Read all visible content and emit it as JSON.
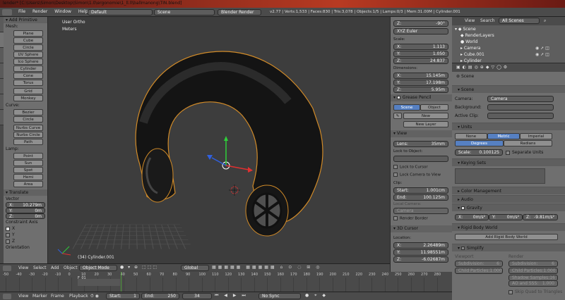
{
  "window": {
    "title": "lender* [C:\\Users\\Simon\\Desktop\\Simon\\1.0\\ergonomie\\1_ll.ll\\ballmanong\\TIN.blend]"
  },
  "topbar": {
    "menus": [
      "File",
      "Render",
      "Window",
      "Help"
    ],
    "layout": "Default",
    "scene": "Scene",
    "engine": "Blender Render",
    "stats": "v2.77 | Verts:1,533 | Faces:830 | Tris:3,078 | Objects:1/5 | Lamps:0/3 | Mem:31.00M | Cylinder.001"
  },
  "toolshelf": {
    "tabs": [
      "Tools",
      "Create",
      "Relations",
      "Animation",
      "Physics",
      "Grease Pencil",
      "Bl Printing"
    ],
    "header": "Add Primitive",
    "mesh_label": "Mesh:",
    "mesh": [
      "Plane",
      "Cube",
      "Circle",
      "UV Sphere",
      "Ico Sphere",
      "Cylinder",
      "Cone",
      "Torus",
      "Grid",
      "Monkey"
    ],
    "curve_label": "Curve:",
    "curve": [
      "Bezier",
      "Circle",
      "Nurbs Curve",
      "Nurbs Circle",
      "Path"
    ],
    "lamp_label": "Lamp:",
    "lamp": [
      "Point",
      "Sun",
      "Spot",
      "Hemi",
      "Area"
    ],
    "op_header": "Translate",
    "vector_label": "Vector",
    "vector": [
      {
        "k": "X:",
        "v": "10.279m"
      },
      {
        "k": "Y:",
        "v": "0m"
      },
      {
        "k": "Z:",
        "v": "0m"
      }
    ],
    "constraint_label": "Constraint Axis",
    "axes": [
      "X",
      "Y",
      "Z"
    ],
    "orientation": "Orientation"
  },
  "viewport": {
    "view_name": "User Ortho",
    "units": "Meters",
    "object_label": "(34) Cylinder.001"
  },
  "npanel": {
    "rot_z": "-90°",
    "rot_mode": "XYZ Euler",
    "scale_label": "Scale:",
    "scale": [
      {
        "k": "X:",
        "v": "1.113"
      },
      {
        "k": "Y:",
        "v": "1.050"
      },
      {
        "k": "Z:",
        "v": "24.837"
      }
    ],
    "dim_label": "Dimensions:",
    "dim": [
      {
        "k": "X:",
        "v": "15.145m"
      },
      {
        "k": "Y:",
        "v": "17.198m"
      },
      {
        "k": "Z:",
        "v": "5.95m"
      }
    ],
    "gp_header": "Grease Pencil",
    "gp_scene": "Scene",
    "gp_object": "Object",
    "gp_new": "New",
    "gp_newlayer": "New Layer",
    "view_header": "View",
    "lens": "Lens:",
    "lens_val": "35mm",
    "lock_obj": "Lock to Object:",
    "lock_cursor": "Lock to Cursor",
    "lock_camera": "Lock Camera to View",
    "clip": "Clip:",
    "clip_start": "Start:",
    "clip_start_val": "1.001cm",
    "clip_end": "End:",
    "clip_end_val": "100.125m",
    "local_camera": "Local Camera:",
    "camera": "Camera",
    "render_border": "Render Border",
    "cursor_header": "3D Cursor",
    "location": "Location:",
    "loc": [
      {
        "k": "X:",
        "v": "2.26489m"
      },
      {
        "k": "Y:",
        "v": "11.98551m"
      },
      {
        "k": "Z:",
        "v": "-6.02687m"
      }
    ]
  },
  "outliner": {
    "menus": [
      "View",
      "Search"
    ],
    "filter": "All Scenes",
    "items": [
      "Scene",
      "RenderLayers",
      "World",
      "Camera",
      "Cube.001",
      "Cylinder"
    ]
  },
  "props": {
    "breadcrumb": "Scene",
    "scene_header": "Scene",
    "camera_label": "Camera:",
    "camera_val": "Camera",
    "bg_label": "Background:",
    "clip_label": "Active Clip:",
    "units_header": "Units",
    "unit_systems": [
      "None",
      "Metric",
      "Imperial"
    ],
    "rot_units": [
      "Degrees",
      "Radians"
    ],
    "scale_label": "Scale:",
    "scale_val": "0.100125",
    "sep_units": "Separate Units",
    "keying": "Keying Sets",
    "color_mgmt": "Color Management",
    "audio": "Audio",
    "gravity": "Gravity",
    "gravity_vals": [
      {
        "k": "X:",
        "v": "0m/s²"
      },
      {
        "k": "Y:",
        "v": "0m/s²"
      },
      {
        "k": "Z:",
        "v": "-9.81m/s²"
      }
    ],
    "rigid": "Rigid Body World",
    "add_rigid": "Add Rigid Body World",
    "simplify": "Simplify",
    "viewport_label": "Viewport",
    "render_label": "Render",
    "subdivision": "Subdivision:",
    "subdiv_val": "6",
    "child": "Child Particles:",
    "child_val": "1.000",
    "shadow": "Shadow Samples:",
    "shadow_val": "16",
    "ao": "AO and SSS:",
    "ao_val": "1.000",
    "skip": "Skip Quad to Triangles"
  },
  "view3d_header": {
    "menus": [
      "View",
      "Select",
      "Add",
      "Object"
    ],
    "mode": "Object Mode",
    "orientation": "Global"
  },
  "timeline": {
    "ticks": [
      "-50",
      "-40",
      "-30",
      "-20",
      "-10",
      "0",
      "10",
      "20",
      "30",
      "40",
      "50",
      "60",
      "70",
      "80",
      "90",
      "100",
      "110",
      "120",
      "130",
      "140",
      "150",
      "160",
      "170",
      "180",
      "190",
      "200",
      "210",
      "220",
      "230",
      "240",
      "250",
      "260",
      "270",
      "280"
    ],
    "frame_marker": "F_01",
    "menus": [
      "View",
      "Marker",
      "Frame",
      "Playback"
    ],
    "start_label": "Start:",
    "start": "1",
    "end_label": "End:",
    "end": "250",
    "current": "34",
    "sync": "No Sync"
  }
}
